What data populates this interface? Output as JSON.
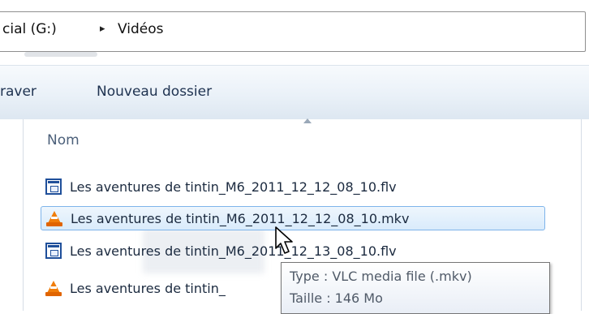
{
  "address_bar": {
    "drive": "cial (G:)",
    "separator": "▸",
    "folder": "Vidéos"
  },
  "toolbar": {
    "prev_label": "raver",
    "new_folder_label": "Nouveau dossier"
  },
  "columns": {
    "name_header": "Nom"
  },
  "files": [
    {
      "name": "Les aventures de tintin_M6_2011_12_12_08_10.flv",
      "icon": "video-file-icon"
    },
    {
      "name": "Les aventures de tintin_M6_2011_12_12_08_10.mkv",
      "icon": "vlc-icon",
      "selected": true
    },
    {
      "name": "Les aventures de tintin_M6_2011_12_13_08_10.flv",
      "icon": "video-file-icon"
    },
    {
      "name": "Les aventures de tintin_",
      "icon": "vlc-icon"
    }
  ],
  "tooltip": {
    "type_line": "Type : VLC media file (.mkv)",
    "size_line": "Taille : 146 Mo"
  }
}
